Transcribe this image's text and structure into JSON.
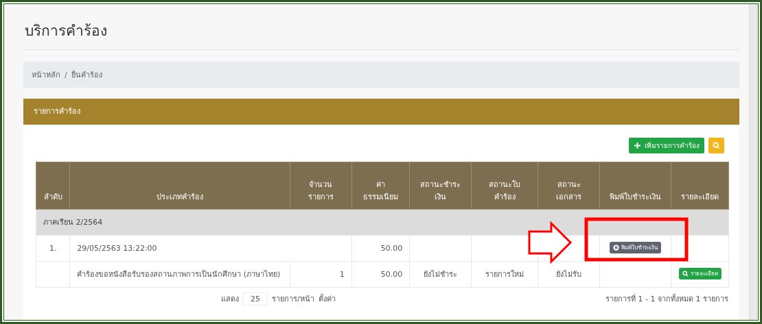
{
  "page_title": "บริการคำร้อง",
  "breadcrumb": {
    "items": [
      {
        "label": "หน้าหลัก"
      },
      {
        "label": "ยื่นคำร้อง"
      }
    ],
    "separator": "/"
  },
  "card": {
    "title": "รายการคำร้อง",
    "add_button": "เพิ่มรายการคำร้อง"
  },
  "table": {
    "columns": [
      "ลำดับ",
      "ประเภทคำร้อง",
      "จำนวน\nรายการ",
      "ค่า\nธรรมเนียม",
      "สถานะชำระ\nเงิน",
      "สถานะใบ\nคำร้อง",
      "สถานะ\nเอกสาร",
      "พิมพ์ใบชำระเงิน",
      "รายละเอียด"
    ],
    "rows": [
      {
        "kind": "group",
        "label": "ภาคเรียน 2/2564"
      },
      {
        "kind": "request",
        "number": "1.",
        "submitted": "29/05/2563 13:22:00",
        "fee": "50.00",
        "print_button": "พิมพ์ใบชำระเงิน"
      },
      {
        "kind": "item",
        "type": "คำร้องขอหนังสือรับรองสถานภาพการเป็นนักศึกษา (ภาษาไทย)",
        "count": "1",
        "fee": "50.00",
        "payment_status": "ยังไม่ชำระ",
        "request_status": "รายการใหม่",
        "document_status": "ยังไม่รับ",
        "detail_button": "รายละเอียด"
      }
    ]
  },
  "footer": {
    "show_label": "แสดง",
    "page_size": "25",
    "per_page_label": "รายการ/หน้า",
    "settings_link": "ตั้งค่า",
    "summary": "รายการที่ 1 - 1 จากทั้งหมด 1 รายการ"
  }
}
